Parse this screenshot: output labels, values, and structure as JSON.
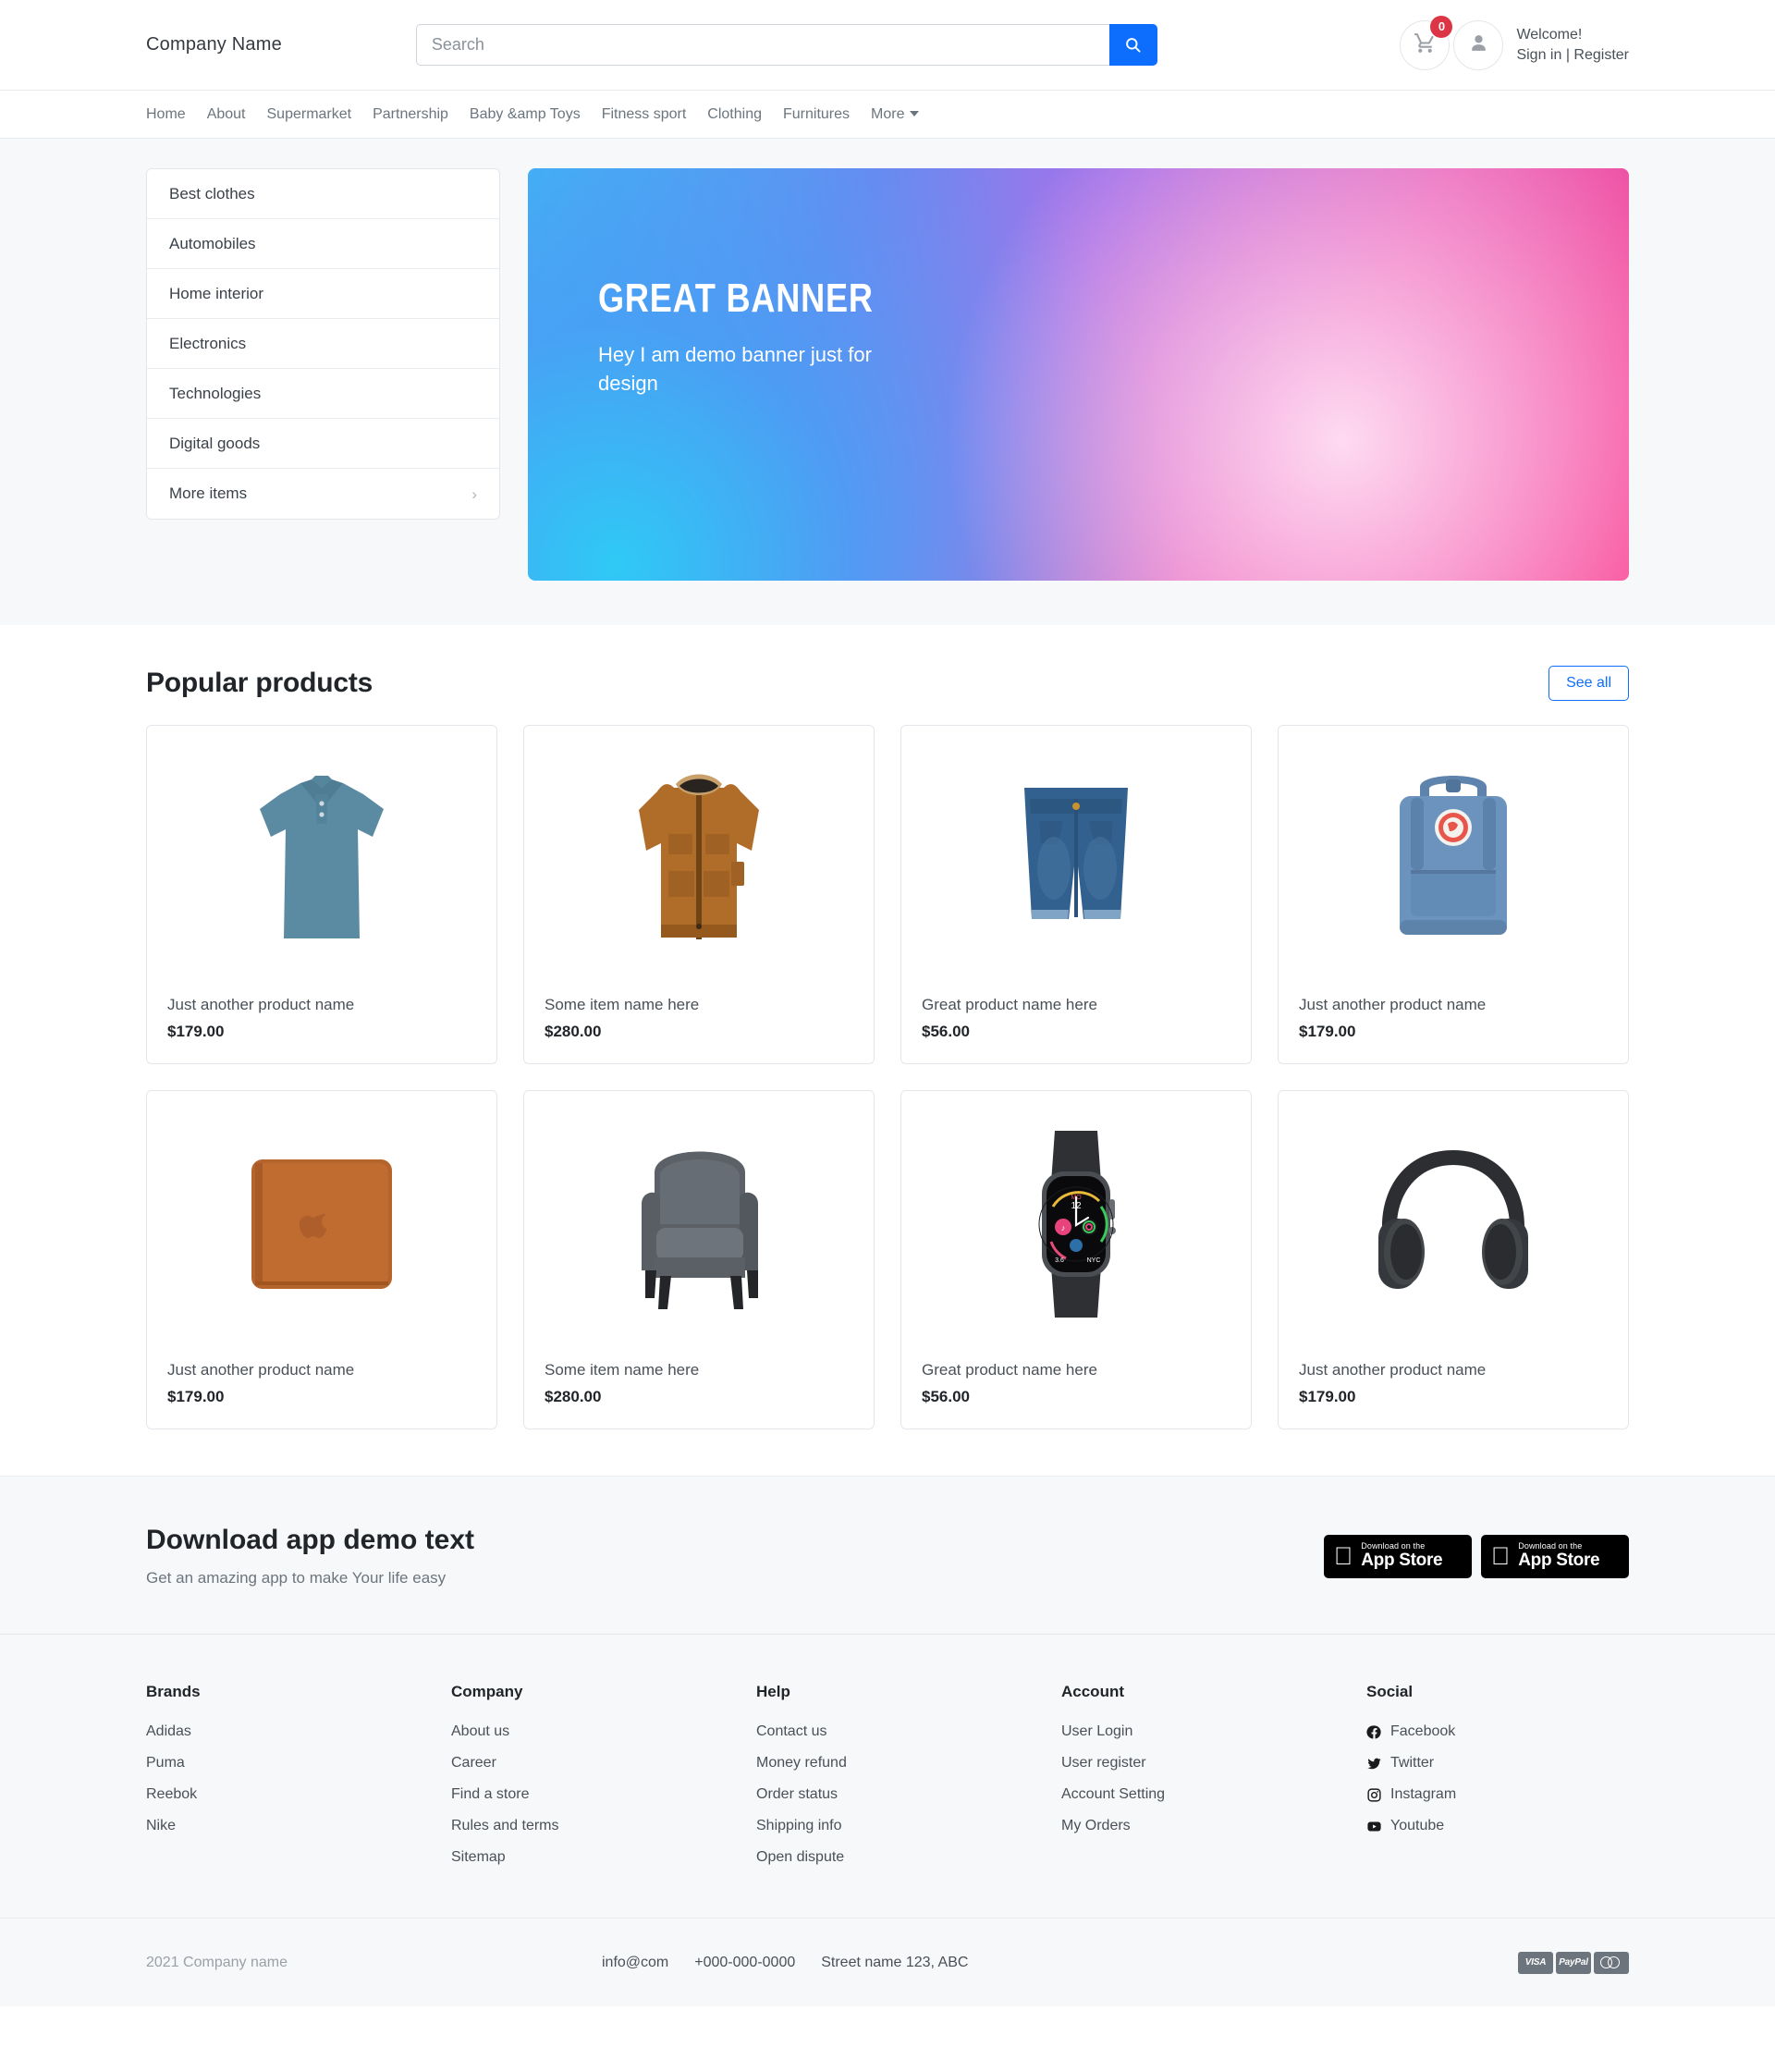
{
  "header": {
    "brand": "Company Name",
    "search": {
      "placeholder": "Search",
      "value": "",
      "icon": "search-icon"
    },
    "cart": {
      "icon": "cart-icon",
      "badge_count": "0"
    },
    "account": {
      "icon": "user-icon"
    },
    "welcome_line1": "Welcome!",
    "signin_label": "Sign in",
    "separator": " | ",
    "register_label": "Register"
  },
  "nav": {
    "items": [
      {
        "label": "Home"
      },
      {
        "label": "About"
      },
      {
        "label": "Supermarket"
      },
      {
        "label": "Partnership"
      },
      {
        "label": "Baby &amp Toys"
      },
      {
        "label": "Fitness sport"
      },
      {
        "label": "Clothing"
      },
      {
        "label": "Furnitures"
      }
    ],
    "more_label": "More",
    "more_icon": "chevron-down-icon"
  },
  "sidebar": {
    "items": [
      {
        "label": "Best clothes"
      },
      {
        "label": "Automobiles"
      },
      {
        "label": "Home interior"
      },
      {
        "label": "Electronics"
      },
      {
        "label": "Technologies"
      },
      {
        "label": "Digital goods"
      },
      {
        "label": "More items",
        "chevron": "›"
      }
    ]
  },
  "banner": {
    "title": "GREAT BANNER",
    "subtitle": "Hey I am demo banner just for design",
    "gradient_from": "#41b8f5",
    "gradient_to": "#f8418f"
  },
  "popular": {
    "title": "Popular products",
    "see_all_label": "See all",
    "accent_color": "#0d6efd",
    "products": [
      {
        "name": "Just another product name",
        "price": "$179.00",
        "image": "polo-shirt-image"
      },
      {
        "name": "Some item name here",
        "price": "$280.00",
        "image": "winter-parka-image"
      },
      {
        "name": "Great product name here",
        "price": "$56.00",
        "image": "denim-shorts-image"
      },
      {
        "name": "Just another product name",
        "price": "$179.00",
        "image": "blue-backpack-image"
      },
      {
        "name": "Just another product name",
        "price": "$179.00",
        "image": "leather-sleeve-image"
      },
      {
        "name": "Some item name here",
        "price": "$280.00",
        "image": "grey-armchair-image"
      },
      {
        "name": "Great product name here",
        "price": "$56.00",
        "image": "smart-watch-image"
      },
      {
        "name": "Just another product name",
        "price": "$179.00",
        "image": "headphones-image"
      }
    ]
  },
  "app_promo": {
    "title": "Download app demo text",
    "subtitle": "Get an amazing app to make Your life easy",
    "badges": [
      {
        "small": "Download on the",
        "big": "App Store",
        "icon": "apple-icon"
      },
      {
        "small": "Download on the",
        "big": "App Store",
        "icon": "apple-icon"
      }
    ]
  },
  "footer": {
    "columns": [
      {
        "title": "Brands",
        "links": [
          "Adidas",
          "Puma",
          "Reebok",
          "Nike"
        ]
      },
      {
        "title": "Company",
        "links": [
          "About us",
          "Career",
          "Find a store",
          "Rules and terms",
          "Sitemap"
        ]
      },
      {
        "title": "Help",
        "links": [
          "Contact us",
          "Money refund",
          "Order status",
          "Shipping info",
          "Open dispute"
        ]
      },
      {
        "title": "Account",
        "links": [
          "User Login",
          "User register",
          "Account Setting",
          "My Orders"
        ]
      }
    ],
    "social": {
      "title": "Social",
      "links": [
        {
          "label": "Facebook",
          "icon": "facebook-icon"
        },
        {
          "label": "Twitter",
          "icon": "twitter-icon"
        },
        {
          "label": "Instagram",
          "icon": "instagram-icon"
        },
        {
          "label": "Youtube",
          "icon": "youtube-icon"
        }
      ]
    }
  },
  "bottombar": {
    "copyright": "2021 Company name",
    "email": "info@com",
    "phone": "+000-000-0000",
    "address": "Street name 123, ABC",
    "payments": [
      {
        "label": "VISA",
        "icon": "visa-icon"
      },
      {
        "label": "PayPal",
        "icon": "paypal-icon"
      },
      {
        "label": "",
        "icon": "mastercard-icon"
      }
    ]
  }
}
